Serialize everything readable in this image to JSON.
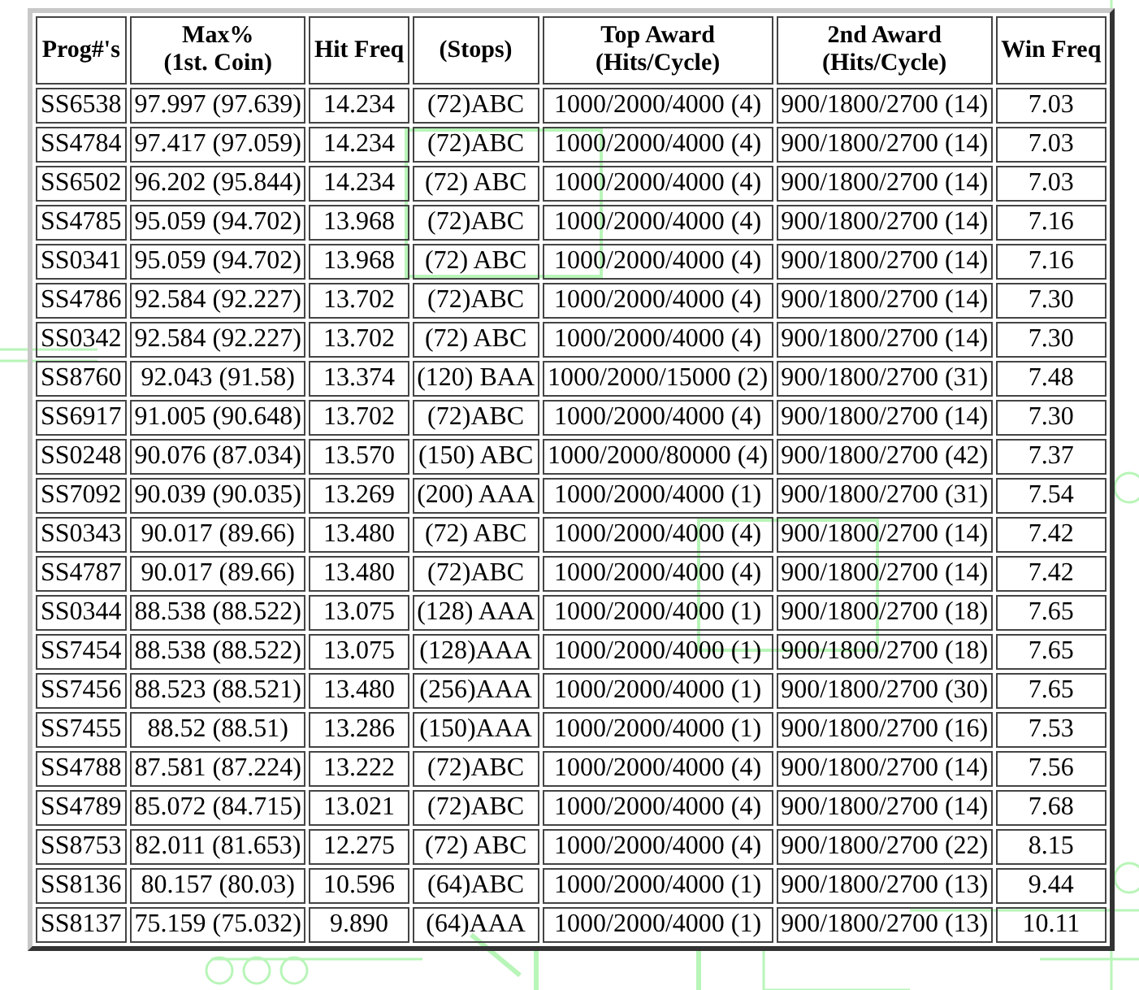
{
  "table": {
    "columns": [
      "Prog#'s",
      "Max%\n(1st. Coin)",
      "Hit Freq",
      "(Stops)",
      "Top Award\n(Hits/Cycle)",
      "2nd Award\n(Hits/Cycle)",
      "Win Freq"
    ],
    "rows": [
      [
        "SS6538",
        "97.997 (97.639)",
        "14.234",
        "(72)ABC",
        "1000/2000/4000 (4)",
        "900/1800/2700 (14)",
        "7.03"
      ],
      [
        "SS4784",
        "97.417 (97.059)",
        "14.234",
        "(72)ABC",
        "1000/2000/4000 (4)",
        "900/1800/2700 (14)",
        "7.03"
      ],
      [
        "SS6502",
        "96.202 (95.844)",
        "14.234",
        "(72) ABC",
        "1000/2000/4000 (4)",
        "900/1800/2700 (14)",
        "7.03"
      ],
      [
        "SS4785",
        "95.059 (94.702)",
        "13.968",
        "(72)ABC",
        "1000/2000/4000 (4)",
        "900/1800/2700 (14)",
        "7.16"
      ],
      [
        "SS0341",
        "95.059 (94.702)",
        "13.968",
        "(72) ABC",
        "1000/2000/4000 (4)",
        "900/1800/2700 (14)",
        "7.16"
      ],
      [
        "SS4786",
        "92.584 (92.227)",
        "13.702",
        "(72)ABC",
        "1000/2000/4000 (4)",
        "900/1800/2700 (14)",
        "7.30"
      ],
      [
        "SS0342",
        "92.584 (92.227)",
        "13.702",
        "(72) ABC",
        "1000/2000/4000 (4)",
        "900/1800/2700 (14)",
        "7.30"
      ],
      [
        "SS8760",
        "92.043 (91.58)",
        "13.374",
        "(120) BAA",
        "1000/2000/15000 (2)",
        "900/1800/2700 (31)",
        "7.48"
      ],
      [
        "SS6917",
        "91.005 (90.648)",
        "13.702",
        "(72)ABC",
        "1000/2000/4000 (4)",
        "900/1800/2700 (14)",
        "7.30"
      ],
      [
        "SS0248",
        "90.076 (87.034)",
        "13.570",
        "(150) ABC",
        "1000/2000/80000 (4)",
        "900/1800/2700 (42)",
        "7.37"
      ],
      [
        "SS7092",
        "90.039 (90.035)",
        "13.269",
        "(200) AAA",
        "1000/2000/4000 (1)",
        "900/1800/2700 (31)",
        "7.54"
      ],
      [
        "SS0343",
        "90.017 (89.66)",
        "13.480",
        "(72) ABC",
        "1000/2000/4000 (4)",
        "900/1800/2700 (14)",
        "7.42"
      ],
      [
        "SS4787",
        "90.017 (89.66)",
        "13.480",
        "(72)ABC",
        "1000/2000/4000 (4)",
        "900/1800/2700 (14)",
        "7.42"
      ],
      [
        "SS0344",
        "88.538 (88.522)",
        "13.075",
        "(128) AAA",
        "1000/2000/4000 (1)",
        "900/1800/2700 (18)",
        "7.65"
      ],
      [
        "SS7454",
        "88.538 (88.522)",
        "13.075",
        "(128)AAA",
        "1000/2000/4000 (1)",
        "900/1800/2700 (18)",
        "7.65"
      ],
      [
        "SS7456",
        "88.523 (88.521)",
        "13.480",
        "(256)AAA",
        "1000/2000/4000 (1)",
        "900/1800/2700 (30)",
        "7.65"
      ],
      [
        "SS7455",
        "88.52 (88.51)",
        "13.286",
        "(150)AAA",
        "1000/2000/4000 (1)",
        "900/1800/2700 (16)",
        "7.53"
      ],
      [
        "SS4788",
        "87.581 (87.224)",
        "13.222",
        "(72)ABC",
        "1000/2000/4000 (4)",
        "900/1800/2700 (14)",
        "7.56"
      ],
      [
        "SS4789",
        "85.072 (84.715)",
        "13.021",
        "(72)ABC",
        "1000/2000/4000 (4)",
        "900/1800/2700 (14)",
        "7.68"
      ],
      [
        "SS8753",
        "82.011 (81.653)",
        "12.275",
        "(72) ABC",
        "1000/2000/4000 (4)",
        "900/1800/2700 (22)",
        "8.15"
      ],
      [
        "SS8136",
        "80.157 (80.03)",
        "10.596",
        "(64)ABC",
        "1000/2000/4000 (1)",
        "900/1800/2700 (13)",
        "9.44"
      ],
      [
        "SS8137",
        "75.159 (75.032)",
        "9.890",
        "(64)AAA",
        "1000/2000/4000 (1)",
        "900/1800/2700 (13)",
        "10.11"
      ]
    ]
  }
}
